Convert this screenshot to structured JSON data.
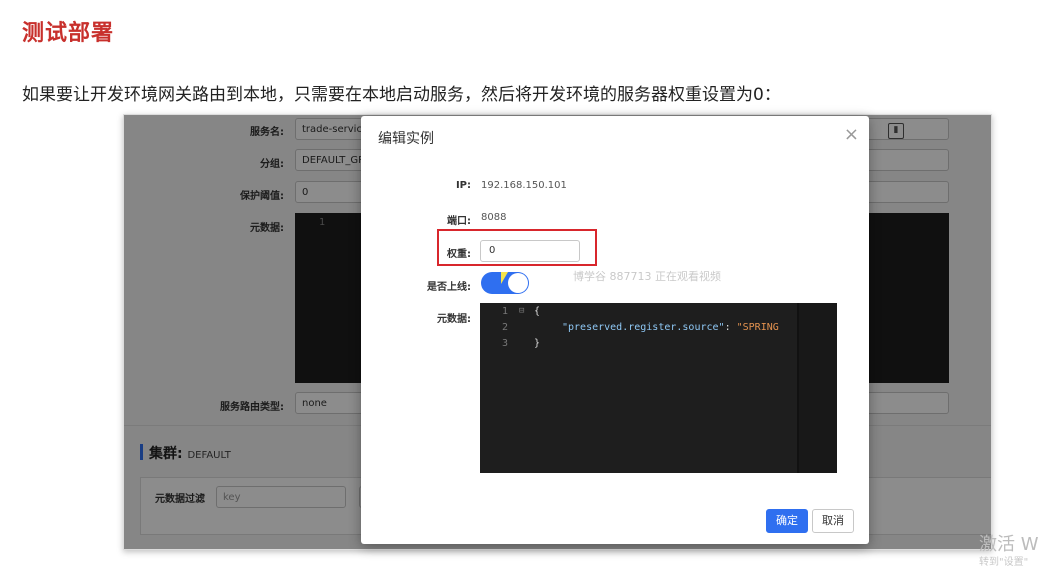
{
  "doc": {
    "title": "测试部署",
    "intro": "如果要让开发环境网关路由到本地，只需要在本地启动服务，然后将开发环境的服务器权重设置为0："
  },
  "background": {
    "service_name_label": "服务名:",
    "service_name_value": "trade-service",
    "group_label": "分组:",
    "group_value": "DEFAULT_GR",
    "protect_label": "保护阈值:",
    "protect_value": "0",
    "metadata_label": "元数据:",
    "editor_line": "1",
    "route_type_label": "服务路由类型:",
    "route_type_value": "none",
    "cluster_label": "集群:",
    "cluster_value": "DEFAULT",
    "filter_label": "元数据过滤",
    "filter_placeholder": "key"
  },
  "modal": {
    "title": "编辑实例",
    "close": "×",
    "ip_label": "IP:",
    "ip_value": "192.168.150.101",
    "port_label": "端口:",
    "port_value": "8088",
    "weight_label": "权重:",
    "weight_value": "0",
    "online_label": "是否上线:",
    "online": true,
    "metadata_label": "元数据:",
    "editor": {
      "line1_no": "1",
      "line1_fold": "⊟",
      "line1_code": "{",
      "line2_no": "2",
      "line2_key": "\"preserved.register.source\"",
      "line2_colon": ": ",
      "line2_str": "\"SPRING",
      "line3_no": "3",
      "line3_code": "}"
    },
    "confirm": "确定",
    "cancel": "取消"
  },
  "watermark": "博学谷 887713 正在观看视频",
  "os_watermark": {
    "line1": "激活 W",
    "line2": "转到\"设置\""
  },
  "colors": {
    "title_red": "#c8302c",
    "highlight_red": "#d8262c",
    "primary_blue": "#2f6ff0",
    "editor_bg": "#1e1e1e"
  }
}
